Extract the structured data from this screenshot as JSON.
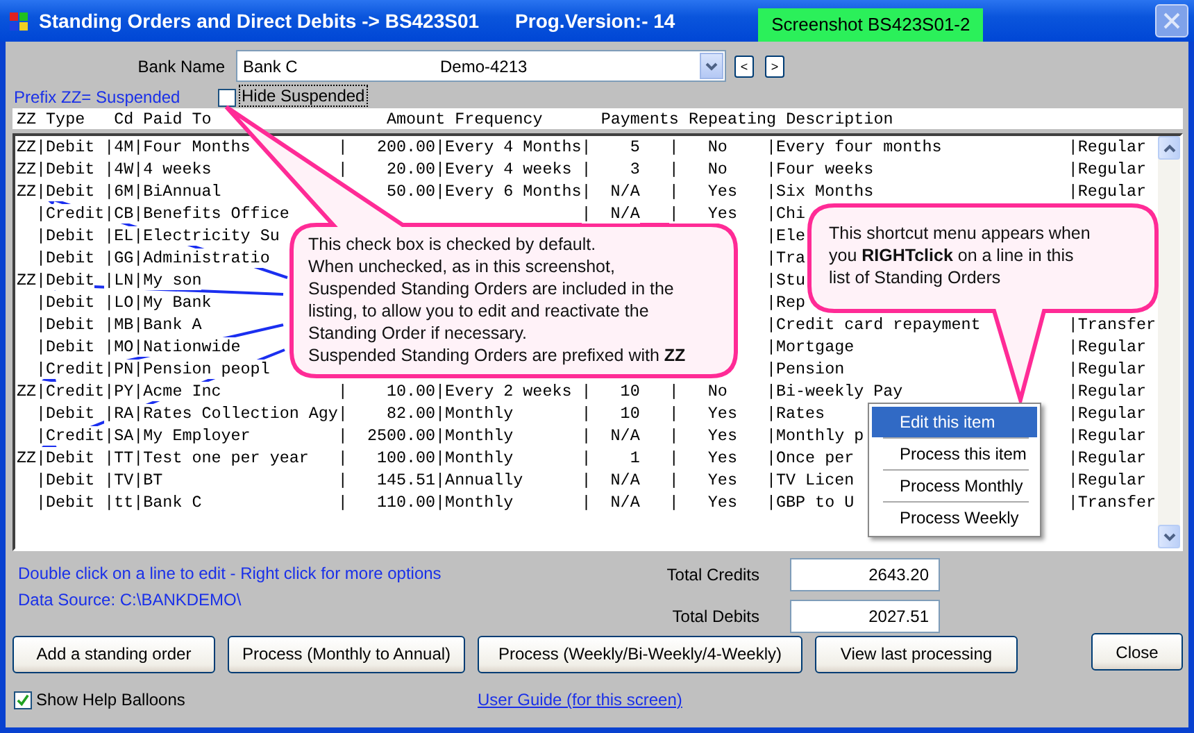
{
  "window": {
    "title": "Standing Orders and Direct Debits -> BS423S01",
    "version": "Prog.Version:-  14",
    "badge": "Screenshot BS423S01-2"
  },
  "bank": {
    "label": "Bank Name",
    "value": "Bank C",
    "account": "Demo-4213"
  },
  "nav_buttons": [
    "<",
    ">"
  ],
  "prefix_note": "Prefix ZZ= Suspended",
  "hide_suspended": {
    "label": "Hide Suspended",
    "checked": false
  },
  "list": {
    "header": "ZZ Type   Cd Paid To                  Amount Frequency      Payments Repeating Description",
    "rows": [
      {
        "zz": "ZZ",
        "type": "|Debit",
        "code": "|4M",
        "paid_to": "|Four Months",
        "amount": "|   200.00",
        "frequency": "|Every 4 Months",
        "payments": "|    5",
        "repeating": "|   No",
        "description": "|Every four months",
        "category": "|Regular"
      },
      {
        "zz": "ZZ",
        "type": "|Debit",
        "code": "|4W",
        "paid_to": "|4 weeks",
        "amount": "|    20.00",
        "frequency": "|Every 4 weeks",
        "payments": "|    3",
        "repeating": "|   No",
        "description": "|Four weeks",
        "category": "|Regular"
      },
      {
        "zz": "ZZ",
        "type": "|Debit",
        "code": "|6M",
        "paid_to": "|BiAnnual",
        "amount": "50.00",
        "frequency": "|Every 6 Months",
        "payments": "|  N/A",
        "repeating": "|   Yes",
        "description": "|Six Months",
        "category": "|Regular"
      },
      {
        "type": "|Credit",
        "code": "|CB",
        "paid_to": "|Benefits Office",
        "payments": "|  N/A",
        "repeating": "|   Yes",
        "description": "|Chi"
      },
      {
        "type": "|Debit",
        "code": "|EL",
        "paid_to": "|Electricity Su",
        "description": "|Ele"
      },
      {
        "type": "|Debit",
        "code": "|GG",
        "paid_to": "|Administratio",
        "description": "|Tra"
      },
      {
        "zz": "ZZ",
        "type": "|Debit",
        "code": "|LN",
        "paid_to": "|My son",
        "description": "|Stu"
      },
      {
        "type": "|Debit",
        "code": "|LO",
        "paid_to": "|My Bank",
        "description": "|Rep"
      },
      {
        "type": "|Debit",
        "code": "|MB",
        "paid_to": "|Bank A",
        "description": "|Credit card repayment",
        "category": "|Transfer"
      },
      {
        "type": "|Debit",
        "code": "|MO",
        "paid_to": "|Nationwide",
        "description": "|Mortgage",
        "category": "|Regular"
      },
      {
        "type": "|Credit",
        "code": "|PN",
        "paid_to": "|Pension peopl",
        "description": "|Pension",
        "category": "|Regular"
      },
      {
        "zz": "ZZ",
        "type": "|Credit",
        "code": "|PY",
        "paid_to": "|Acme Inc",
        "amount": "|    10.00",
        "frequency": "|Every 2 weeks",
        "payments": "|   10",
        "repeating": "|   No",
        "description": "|Bi-weekly Pay",
        "category": "|Regular"
      },
      {
        "type": "|Debit",
        "code": "|RA",
        "paid_to": "|Rates Collection Agy",
        "amount": "|    82.00",
        "frequency": "|Monthly",
        "payments": "|   10",
        "repeating": "|   Yes",
        "description": "|Rates",
        "category": "|Regular"
      },
      {
        "type": "|Credit",
        "code": "|SA",
        "paid_to": "|My Employer",
        "amount": "|  2500.00",
        "frequency": "|Monthly",
        "payments": "|  N/A",
        "repeating": "|   Yes",
        "description": "|Monthly p",
        "category": "|Regular"
      },
      {
        "zz": "ZZ",
        "type": "|Debit",
        "code": "|TT",
        "paid_to": "|Test one per year",
        "amount": "|   100.00",
        "frequency": "|Monthly",
        "payments": "|    1",
        "repeating": "|   Yes",
        "description": "|Once per",
        "category": "|Regular"
      },
      {
        "type": "|Debit",
        "code": "|TV",
        "paid_to": "|BT",
        "amount": "|   145.51",
        "frequency": "|Annually",
        "payments": "|  N/A",
        "repeating": "|   Yes",
        "description": "|TV Licen",
        "category": "|Regular"
      },
      {
        "type": "|Debit",
        "code": "|tt",
        "paid_to": "|Bank C",
        "amount": "|   110.00",
        "frequency": "|Monthly",
        "payments": "|  N/A",
        "repeating": "|   Yes",
        "description": "|GBP to U",
        "category": "|Transfer"
      }
    ]
  },
  "help_balloons": [
    {
      "lines": [
        "This check box is checked by default.",
        "When unchecked, as in this screenshot,",
        "Suspended Standing Orders are included in the",
        "listing, to allow you to edit and reactivate the",
        "Standing Order if necessary.",
        "Suspended Standing Orders are prefixed with **ZZ**"
      ]
    },
    {
      "lines": [
        "This shortcut menu appears when",
        "you **RIGHTclick** on a line in this",
        "list of Standing Orders"
      ]
    }
  ],
  "context_menu": {
    "items": [
      {
        "label": "Edit this item",
        "selected": true
      },
      {
        "label": "Process this item",
        "selected": false
      },
      {
        "label": "Process Monthly",
        "selected": false
      },
      {
        "label": "Process Weekly",
        "selected": false
      }
    ]
  },
  "hints": [
    "Double click on a line to edit - Right click for more options",
    "Data Source: C:\\BANKDEMO\\"
  ],
  "totals": [
    {
      "label": "Total Credits",
      "value": "2643.20"
    },
    {
      "label": "Total Debits",
      "value": "2027.51"
    }
  ],
  "buttons": [
    "Add a standing order",
    "Process (Monthly to Annual)",
    "Process (Weekly/Bi-Weekly/4-Weekly)",
    "View last processing"
  ],
  "close_button": "Close",
  "show_help_balloons": {
    "label": "Show Help Balloons",
    "checked": true
  },
  "user_guide_link": "User Guide (for this screen)"
}
